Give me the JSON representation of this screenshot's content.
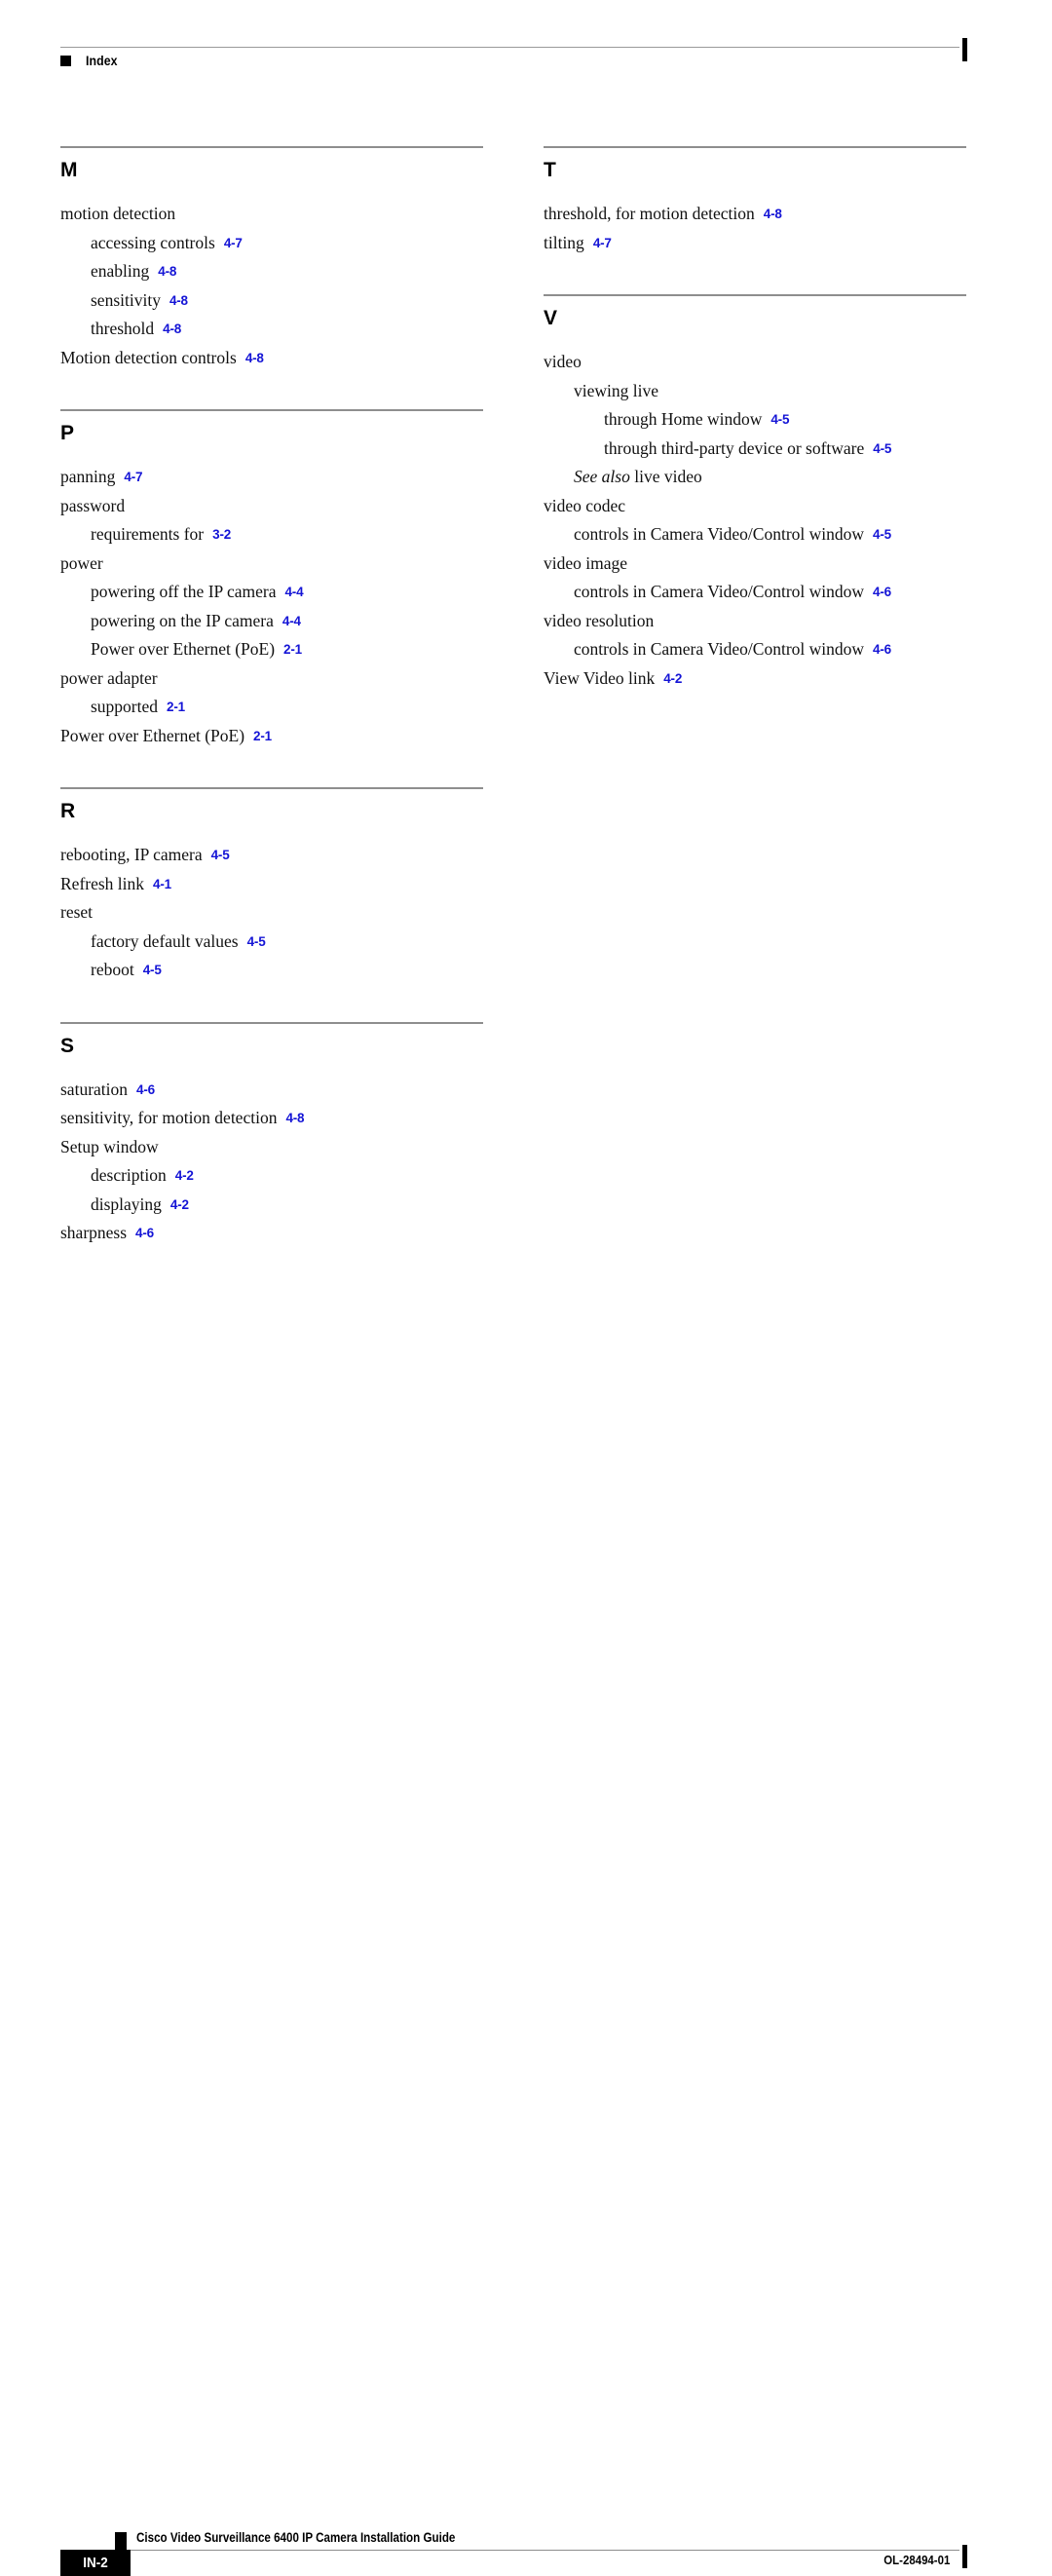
{
  "header": {
    "title": "Index",
    "marker_icon": "black-square-marker"
  },
  "footer": {
    "guide_title": "Cisco Video Surveillance 6400 IP Camera Installation Guide",
    "folio": "IN-2",
    "doc_number": "OL-28494-01",
    "marker_icon": "black-square-marker"
  },
  "colors": {
    "page_reference": "#1414d6",
    "rule": "#8e8e8e",
    "text": "#111111"
  },
  "columns": [
    {
      "id": "left",
      "sections": [
        {
          "letter": "M",
          "entries": [
            {
              "level": 0,
              "term": "motion detection",
              "page": ""
            },
            {
              "level": 1,
              "term": "accessing controls",
              "page": "4-7"
            },
            {
              "level": 1,
              "term": "enabling",
              "page": "4-8"
            },
            {
              "level": 1,
              "term": "sensitivity",
              "page": "4-8"
            },
            {
              "level": 1,
              "term": "threshold",
              "page": "4-8"
            },
            {
              "level": 0,
              "term": "Motion detection controls",
              "page": "4-8"
            }
          ]
        },
        {
          "letter": "P",
          "entries": [
            {
              "level": 0,
              "term": "panning",
              "page": "4-7"
            },
            {
              "level": 0,
              "term": "password",
              "page": ""
            },
            {
              "level": 1,
              "term": "requirements for",
              "page": "3-2"
            },
            {
              "level": 0,
              "term": "power",
              "page": ""
            },
            {
              "level": 1,
              "term": "powering off the IP camera",
              "page": "4-4"
            },
            {
              "level": 1,
              "term": "powering on the IP camera",
              "page": "4-4"
            },
            {
              "level": 1,
              "term": "Power over Ethernet (PoE)",
              "page": "2-1"
            },
            {
              "level": 0,
              "term": "power adapter",
              "page": ""
            },
            {
              "level": 1,
              "term": "supported",
              "page": "2-1"
            },
            {
              "level": 0,
              "term": "Power over Ethernet (PoE)",
              "page": "2-1"
            }
          ]
        },
        {
          "letter": "R",
          "entries": [
            {
              "level": 0,
              "term": "rebooting, IP camera",
              "page": "4-5"
            },
            {
              "level": 0,
              "term": "Refresh link",
              "page": "4-1"
            },
            {
              "level": 0,
              "term": "reset",
              "page": ""
            },
            {
              "level": 1,
              "term": "factory default values",
              "page": "4-5"
            },
            {
              "level": 1,
              "term": "reboot",
              "page": "4-5"
            }
          ]
        },
        {
          "letter": "S",
          "entries": [
            {
              "level": 0,
              "term": "saturation",
              "page": "4-6"
            },
            {
              "level": 0,
              "term": "sensitivity, for motion detection",
              "page": "4-8"
            },
            {
              "level": 0,
              "term": "Setup window",
              "page": ""
            },
            {
              "level": 1,
              "term": "description",
              "page": "4-2"
            },
            {
              "level": 1,
              "term": "displaying",
              "page": "4-2"
            },
            {
              "level": 0,
              "term": "sharpness",
              "page": "4-6"
            }
          ]
        }
      ]
    },
    {
      "id": "right",
      "sections": [
        {
          "letter": "T",
          "entries": [
            {
              "level": 0,
              "term": "threshold, for motion detection",
              "page": "4-8"
            },
            {
              "level": 0,
              "term": "tilting",
              "page": "4-7"
            }
          ]
        },
        {
          "letter": "V",
          "entries": [
            {
              "level": 0,
              "term": "video",
              "page": ""
            },
            {
              "level": 1,
              "term": "viewing live",
              "page": ""
            },
            {
              "level": 2,
              "term": "through Home window",
              "page": "4-5"
            },
            {
              "level": 2,
              "term": "through third-party device or software",
              "page": "4-5"
            },
            {
              "level": 1,
              "term_italic": "See also",
              "term": " live video",
              "page": ""
            },
            {
              "level": 0,
              "term": "video codec",
              "page": ""
            },
            {
              "level": 1,
              "term": "controls in Camera Video/Control window",
              "page": "4-5"
            },
            {
              "level": 0,
              "term": "video image",
              "page": ""
            },
            {
              "level": 1,
              "term": "controls in Camera Video/Control window",
              "page": "4-6"
            },
            {
              "level": 0,
              "term": "video resolution",
              "page": ""
            },
            {
              "level": 1,
              "term": "controls in Camera Video/Control window",
              "page": "4-6"
            },
            {
              "level": 0,
              "term": "View Video link",
              "page": "4-2"
            }
          ]
        }
      ]
    }
  ]
}
